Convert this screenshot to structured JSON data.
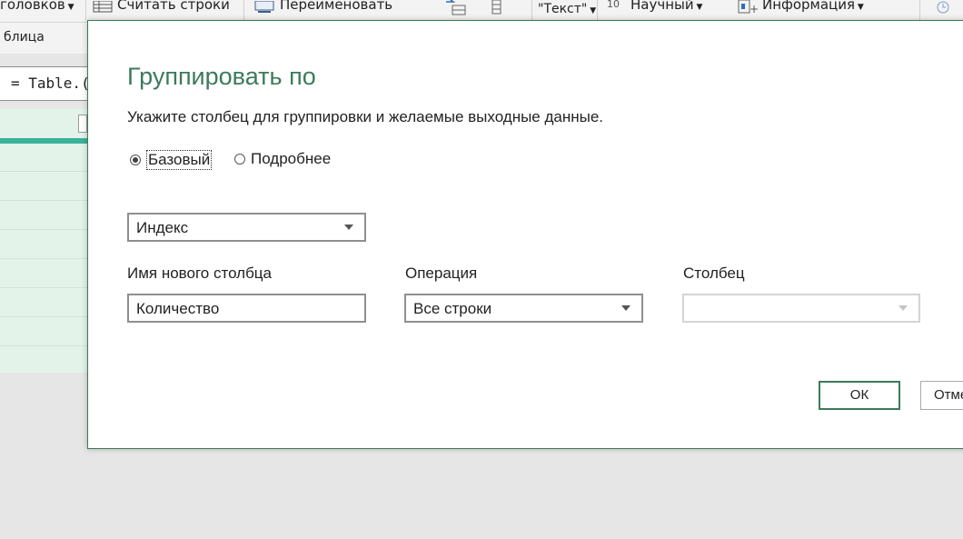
{
  "ribbon": {
    "items": [
      {
        "label": "головков",
        "has_dropdown": true
      },
      {
        "label": "Считать строки"
      },
      {
        "label": "Переименовать"
      },
      {
        "label": "\"Текст\"",
        "has_dropdown": true
      },
      {
        "label": "Научный",
        "has_dropdown": true
      },
      {
        "label": "Информация",
        "has_dropdown": true
      }
    ],
    "superscript": "10"
  },
  "pane": {
    "tab_label": "блица",
    "formula_text": "= Table.("
  },
  "dialog": {
    "title": "Группировать по",
    "subtitle": "Укажите столбец для группировки и желаемые выходные данные.",
    "mode_options": [
      {
        "label": "Базовый",
        "selected": true
      },
      {
        "label": "Подробнее",
        "selected": false
      }
    ],
    "group_by_value": "Индекс",
    "new_column_label": "Имя нового столбца",
    "new_column_value": "Количество",
    "operation_label": "Операция",
    "operation_value": "Все строки",
    "column_label": "Столбец",
    "column_value": "",
    "ok_label": "ОК",
    "cancel_label": "Отме"
  },
  "colors": {
    "accent": "#3c7a5b",
    "grid_bg": "#e3f3ea",
    "teal_bar": "#3bb29a"
  }
}
